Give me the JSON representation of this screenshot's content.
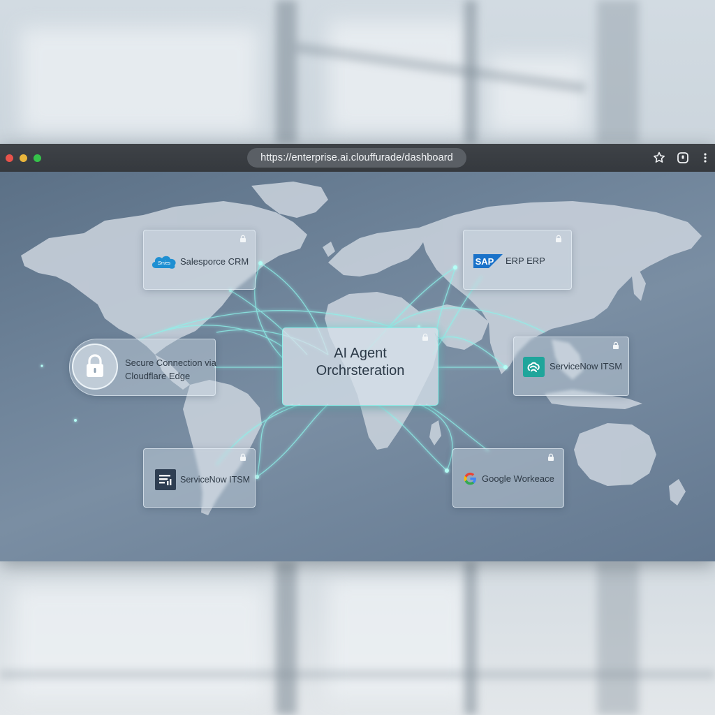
{
  "browser": {
    "url": "https://enterprise.ai.clouffurade/dashboard",
    "window_controls": [
      "close",
      "minimize",
      "maximize"
    ],
    "colors": {
      "close": "#e8534b",
      "minimize": "#e9b53c",
      "maximize": "#35c24a"
    },
    "toolbar_icons": [
      "star-icon",
      "extension-icon",
      "kebab-menu-icon"
    ]
  },
  "dashboard": {
    "center": {
      "title_line1": "AI Agent",
      "title_line2": "Orchrsteration"
    },
    "secure": {
      "line1": "Secure Connection via",
      "line2": "Cloudflare Edge"
    },
    "integrations": [
      {
        "label": "Salesporce CRM",
        "logo_text": "Srries",
        "icon": "salesforce-cloud-icon"
      },
      {
        "label": "ERP ERP",
        "logo_text": "SAP",
        "icon": "sap-logo-icon"
      },
      {
        "label": "ServiceNow ITSM",
        "icon": "servicenow-icon"
      },
      {
        "label": "ServiceNow ITSM",
        "icon": "servicenow-doc-icon"
      },
      {
        "label": "Google Workeace",
        "icon": "google-g-icon"
      }
    ],
    "accent_color": "#8ef2ea"
  }
}
